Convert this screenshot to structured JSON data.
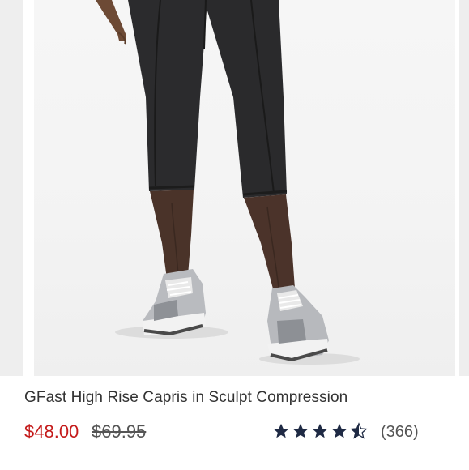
{
  "product": {
    "title": "GFast High Rise Capris in Sculpt Compression",
    "sale_price": "$48.00",
    "original_price": "$69.95",
    "rating": 4.5,
    "rating_max": 5,
    "review_count": "(366)"
  },
  "image": {
    "subject": "model wearing black capri leggings with grey sneakers"
  },
  "colors": {
    "sale_price": "#c41a1a",
    "star": "#1f2a44",
    "leggings": "#2b2b2d"
  },
  "icons": {
    "star": "star-icon",
    "half_star": "star-half-icon"
  }
}
